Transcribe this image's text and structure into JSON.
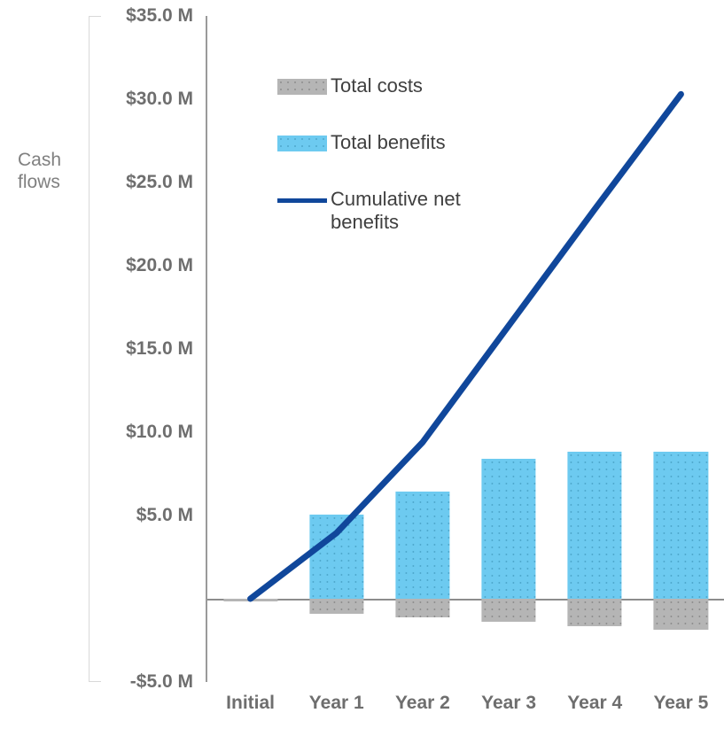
{
  "chart_data": {
    "type": "bar",
    "title": "",
    "subtitle": "",
    "xlabel": "",
    "ylabel": "Cash flows",
    "categories": [
      "Initial",
      "Year 1",
      "Year 2",
      "Year 3",
      "Year 4",
      "Year 5"
    ],
    "ylim": [
      -5.0,
      35.0
    ],
    "ytick_values": [
      35.0,
      30.0,
      25.0,
      20.0,
      15.0,
      10.0,
      5.0,
      -5.0
    ],
    "ytick_labels": [
      "$35.0 M",
      "$30.0 M",
      "$25.0 M",
      "$20.0 M",
      "$15.0 M",
      "$10.0 M",
      "$5.0 M",
      "-$5.0 M"
    ],
    "y_unit": "millions of dollars",
    "grid": false,
    "legend_position": "inside-upper-left",
    "series": [
      {
        "name": "Total costs",
        "type": "bar",
        "color": "#b5b5b5",
        "values": [
          -0.15,
          -0.9,
          -1.1,
          -1.4,
          -1.65,
          -1.85
        ]
      },
      {
        "name": "Total benefits",
        "type": "bar",
        "color": "#6dcaf0",
        "values": [
          0,
          5.05,
          6.45,
          8.4,
          8.85,
          8.85
        ]
      },
      {
        "name": "Cumulative net benefits",
        "type": "line",
        "color": "#10479b",
        "values": [
          0,
          3.95,
          9.4,
          16.4,
          23.4,
          30.3
        ]
      }
    ]
  },
  "legend": {
    "items": [
      {
        "label": "Total costs",
        "marker": "swatch"
      },
      {
        "label": "Total benefits",
        "marker": "swatch"
      },
      {
        "label": "Cumulative net benefits",
        "marker": "line"
      }
    ]
  },
  "colors": {
    "costs": "#b5b5b5",
    "benefits": "#6dcaf0",
    "cumulative_line": "#10479b",
    "axis_text": "#6e6e6e",
    "axis_title_text": "#808080",
    "zero_line": "#8c8c8c",
    "background": "#ffffff"
  }
}
